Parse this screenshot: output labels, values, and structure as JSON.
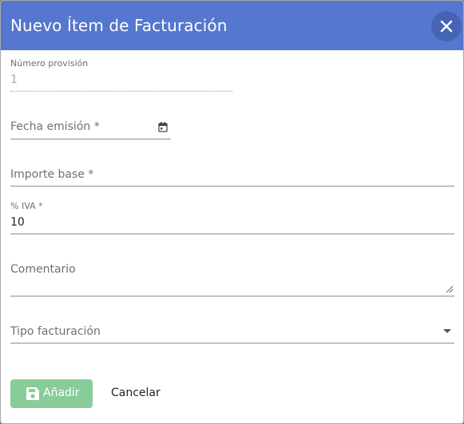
{
  "dialog": {
    "title": "Nuevo Ítem de Facturación",
    "close_icon": "close-icon",
    "header_color": "#5677cf"
  },
  "form": {
    "numero_provision": {
      "label": "Número provisión",
      "value": "1",
      "disabled": true
    },
    "fecha_emision": {
      "label": "Fecha emisión *",
      "value": "",
      "icon": "calendar-icon"
    },
    "importe_base": {
      "label": "Importe base *",
      "value": ""
    },
    "iva": {
      "label": "% IVA *",
      "value": "10"
    },
    "comentario": {
      "label": "Comentario",
      "value": ""
    },
    "tipo_facturacion": {
      "label": "Tipo facturación",
      "selected": "",
      "icon": "dropdown-arrow-icon"
    }
  },
  "actions": {
    "add_label": "Añadir",
    "add_icon": "save-icon",
    "add_color": "#88cc99",
    "cancel_label": "Cancelar"
  }
}
